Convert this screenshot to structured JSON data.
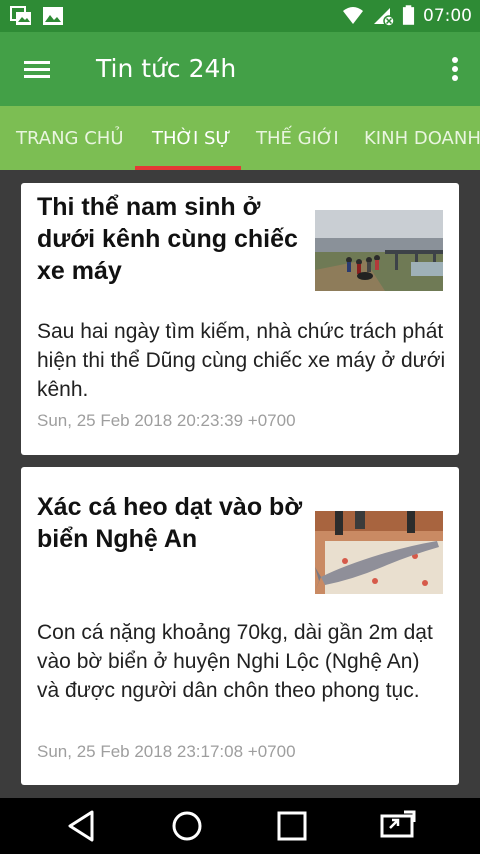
{
  "status_bar": {
    "time": "07:00",
    "left_icons": [
      "gallery-icon",
      "image-icon"
    ],
    "right_icons": [
      "wifi-icon",
      "signal-icon",
      "battery-icon"
    ]
  },
  "app_bar": {
    "title": "Tin tức 24h",
    "menu_icon": "hamburger-menu-icon",
    "more_icon": "more-vert-icon",
    "color": "#43a047"
  },
  "tabs": [
    {
      "label": "TRANG CHỦ",
      "active": false
    },
    {
      "label": "THỜI SỰ",
      "active": true
    },
    {
      "label": "THẾ GIỚI",
      "active": false
    },
    {
      "label": "KINH DOANH",
      "active": false
    }
  ],
  "tab_indicator_color": "#e53935",
  "articles": [
    {
      "title": "Thi thể nam sinh ở dưới kênh cùng chiếc xe máy",
      "summary": "Sau hai ngày tìm kiếm, nhà chức trách phát hiện thi thể Dũng cùng chiếc xe máy ở dưới kênh.",
      "date": "Sun, 25 Feb 2018 20:23:39 +0700"
    },
    {
      "title": "Xác cá heo dạt vào bờ biển Nghệ An",
      "summary": "Con cá nặng khoảng 70kg, dài gần 2m dạt vào bờ biển ở huyện Nghi Lộc (Nghệ An) và được người dân chôn theo phong tục.",
      "date": "Sun, 25 Feb 2018 23:17:08 +0700"
    }
  ],
  "nav_bar": {
    "buttons": [
      "back-icon",
      "home-icon",
      "recents-icon",
      "screen-cast-icon"
    ]
  }
}
